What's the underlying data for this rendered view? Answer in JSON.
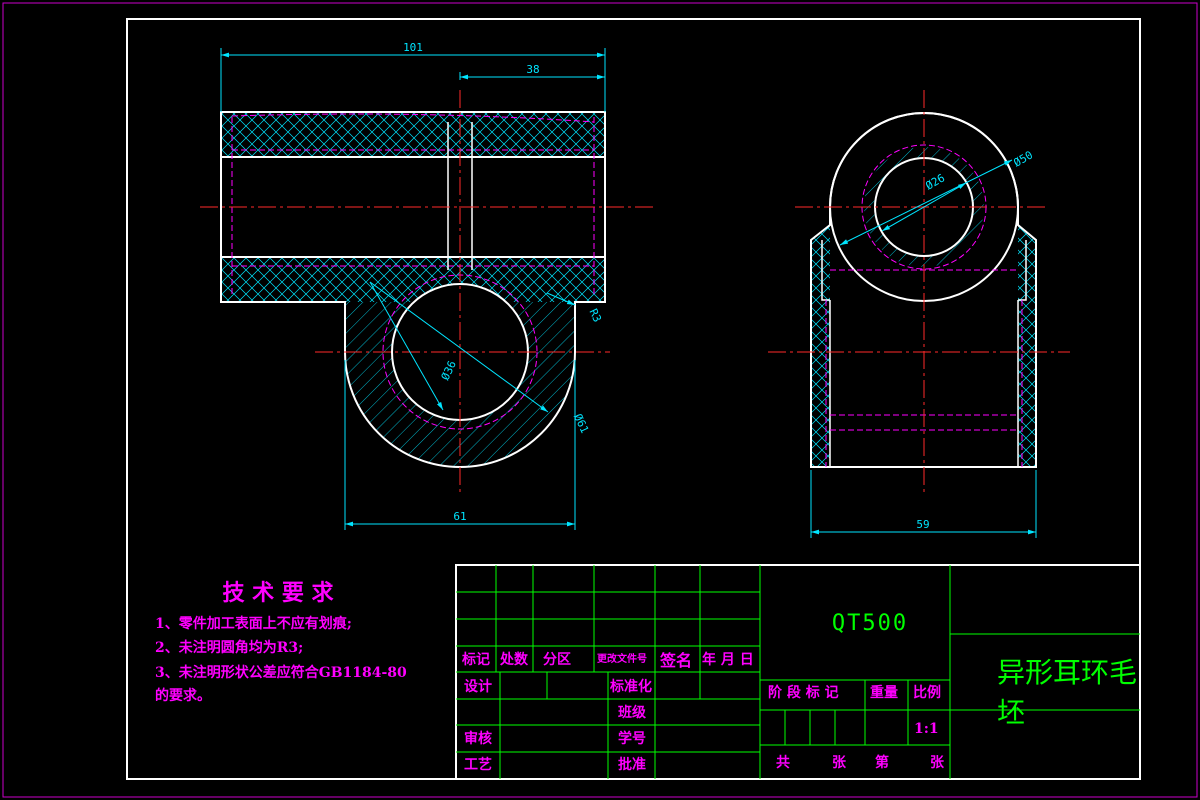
{
  "colors": {
    "background": "#000000",
    "outline": "#ffffff",
    "center_line": "#ff2a2a",
    "dimension": "#00e5ff",
    "hatch": "#00e5ff",
    "hidden": "#ff00ff",
    "table_line": "#00ff00",
    "table_text": "#ff00ff",
    "frame_outer": "#cc00cc"
  },
  "drawing": {
    "front_view": {
      "dims": {
        "overall_length": "101",
        "boss_offset": "38",
        "boss_width": "61",
        "hole_diameter": "Ø36",
        "boss_diameter": "Ø61",
        "fillet": "R3"
      }
    },
    "side_view": {
      "dims": {
        "overall_width": "59",
        "outer_diameter": "Ø50",
        "inner_diameter": "Ø26"
      }
    }
  },
  "tech_requirements": {
    "title": "技 术 要 求",
    "items": [
      "1、零件加工表面上不应有划痕;",
      "2、未注明圆角均为R3;",
      "3、未注明形状公差应符合GB1184-80",
      "的要求。"
    ]
  },
  "title_block": {
    "material": "QT500",
    "part_name_line1": "异形耳环毛",
    "part_name_line2": "坯",
    "revision_headers": [
      "标记",
      "处数",
      "分区",
      "更改文件号",
      "签名",
      "年 月 日"
    ],
    "design": "设计",
    "standardize": "标准化",
    "class": "班级",
    "review": "审核",
    "student_no": "学号",
    "process": "工艺",
    "approve": "批准",
    "stage_mark": "阶 段 标 记",
    "weight": "重量",
    "scale_label": "比例",
    "scale_value": "1:1",
    "total": "共",
    "sheets": "张",
    "sheet_no": "第",
    "sheets2": "张"
  }
}
